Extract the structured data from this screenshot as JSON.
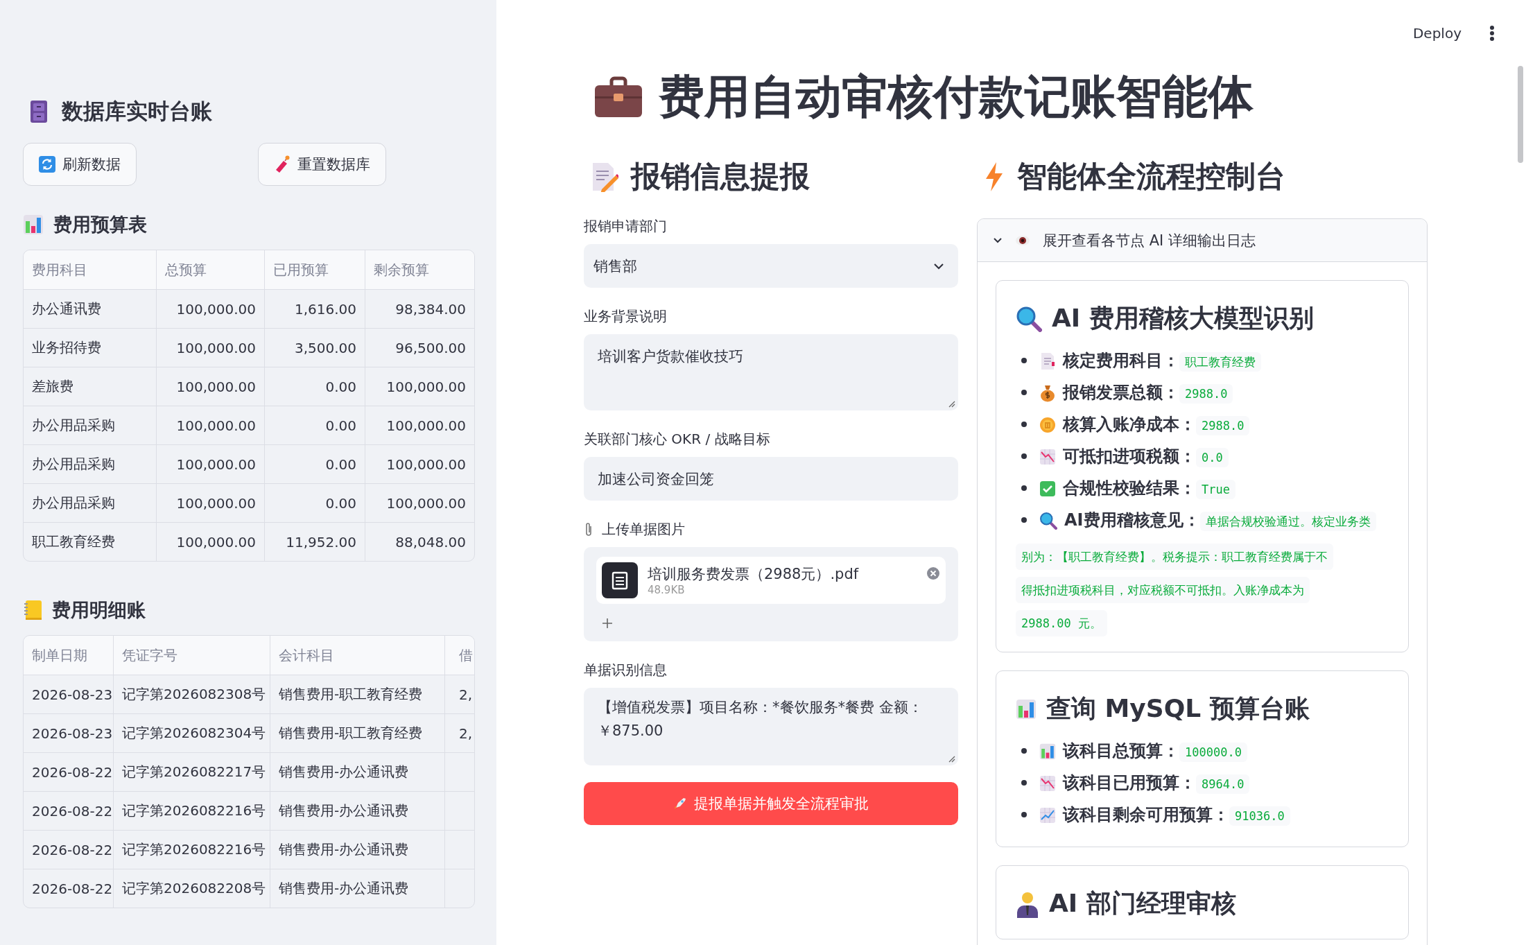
{
  "header": {
    "deploy": "Deploy"
  },
  "sidebar": {
    "title": "数据库实时台账",
    "buttons": [
      "刷新数据",
      "重置数据库"
    ],
    "budget": {
      "title": "费用预算表",
      "columns": [
        "费用科目",
        "总预算",
        "已用预算",
        "剩余预算"
      ],
      "rows": [
        [
          "办公通讯费",
          "100,000.00",
          "1,616.00",
          "98,384.00"
        ],
        [
          "业务招待费",
          "100,000.00",
          "3,500.00",
          "96,500.00"
        ],
        [
          "差旅费",
          "100,000.00",
          "0.00",
          "100,000.00"
        ],
        [
          "办公用品采购",
          "100,000.00",
          "0.00",
          "100,000.00"
        ],
        [
          "办公用品采购",
          "100,000.00",
          "0.00",
          "100,000.00"
        ],
        [
          "办公用品采购",
          "100,000.00",
          "0.00",
          "100,000.00"
        ],
        [
          "职工教育经费",
          "100,000.00",
          "11,952.00",
          "88,048.00"
        ]
      ]
    },
    "ledger": {
      "title": "费用明细账",
      "columns": [
        "制单日期",
        "凭证字号",
        "会计科目",
        "借"
      ],
      "rows": [
        [
          "2026-08-23",
          "记字第2026082308号",
          "销售费用-职工教育经费",
          "2,"
        ],
        [
          "2026-08-23",
          "记字第2026082304号",
          "销售费用-职工教育经费",
          "2,"
        ],
        [
          "2026-08-22",
          "记字第2026082217号",
          "销售费用-办公通讯费"
        ],
        [
          "2026-08-22",
          "记字第2026082216号",
          "销售费用-办公通讯费"
        ],
        [
          "2026-08-22",
          "记字第2026082216号",
          "销售费用-办公通讯费"
        ],
        [
          "2026-08-22",
          "记字第2026082208号",
          "销售费用-办公通讯费"
        ]
      ]
    }
  },
  "page_title": "费用自动审核付款记账智能体",
  "form": {
    "title": "报销信息提报",
    "fields": [
      {
        "kind": "select",
        "label": "报销申请部门",
        "value": "销售部"
      },
      {
        "kind": "textarea",
        "label": "业务背景说明",
        "value": "培训客户货款催收技巧"
      },
      {
        "kind": "input",
        "label": "关联部门核心 OKR / 战略目标",
        "value": "加速公司资金回笼"
      },
      {
        "kind": "upload",
        "label": "上传单据图片",
        "file": {
          "name": "培训服务费发票（2988元）.pdf",
          "size": "48.9KB"
        }
      },
      {
        "kind": "textarea",
        "label": "单据识别信息",
        "value": "【增值税发票】项目名称：*餐饮服务*餐费 金额：￥875.00"
      }
    ],
    "submit": "提报单据并触发全流程审批"
  },
  "console": {
    "title": "智能体全流程控制台",
    "expander": {
      "label": "展开查看各节点 AI 详细输出日志",
      "expanded": true
    },
    "cards": [
      {
        "title": "AI 费用稽核大模型识别",
        "items": [
          {
            "label": "核定费用科目：",
            "value": "职工教育经费"
          },
          {
            "label": "报销发票总额：",
            "value": "2988.0"
          },
          {
            "label": "核算入账净成本：",
            "value": "2988.0"
          },
          {
            "label": "可抵扣进项税额：",
            "value": "0.0"
          },
          {
            "label": "合规性校验结果：",
            "value": "True"
          },
          {
            "label": "AI费用稽核意见：",
            "lines": [
              "单据合规校验通过。核定业务类",
              "别为：【职工教育经费】。税务提示：职工教育经费属于不",
              "得抵扣进项税科目，对应税额不可抵扣。入账净成本为",
              "2988.00 元。"
            ]
          }
        ]
      },
      {
        "title": "查询 MySQL 预算台账",
        "items": [
          {
            "label": "该科目总预算：",
            "value": "100000.0"
          },
          {
            "label": "该科目已用预算：",
            "value": "8964.0"
          },
          {
            "label": "该科目剩余可用预算：",
            "value": "91036.0"
          }
        ]
      },
      {
        "title": "AI 部门经理审核"
      }
    ]
  }
}
